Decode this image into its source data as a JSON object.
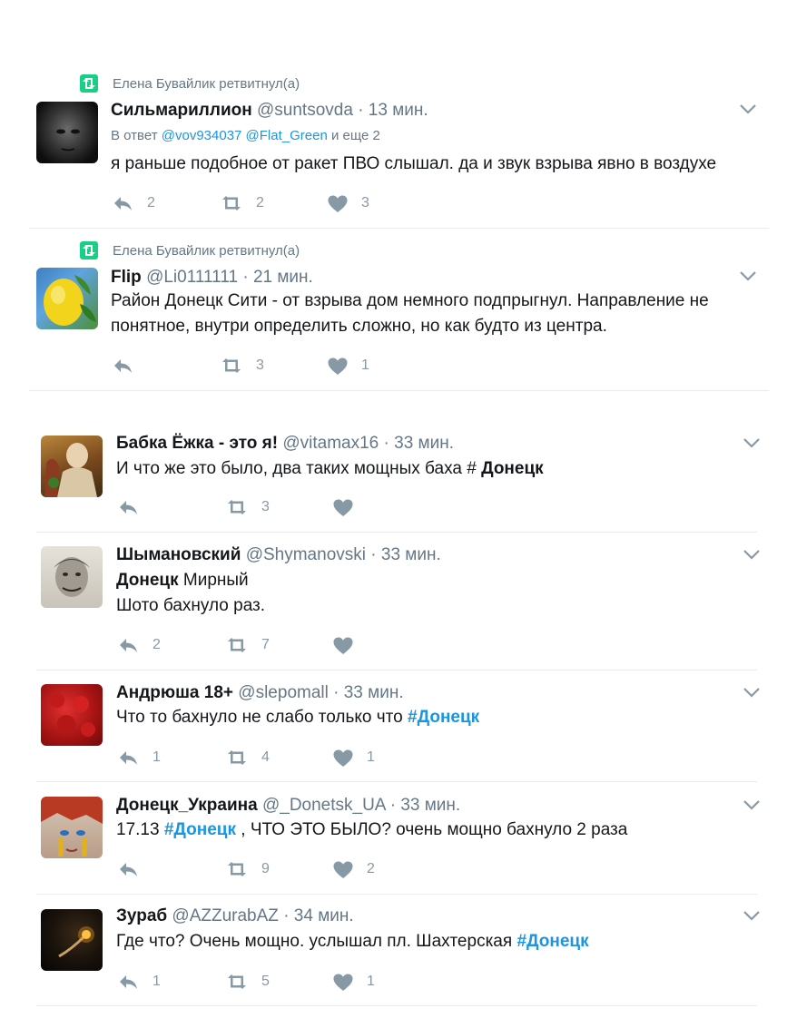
{
  "tweets": [
    {
      "retweeter": "Елена Бувайлик ретвитнул(а)",
      "name": "Сильмариллион",
      "handle": "@suntsovda",
      "time": "13 мин.",
      "reply_prefix": "В ответ",
      "reply_mention1": "@vov934037",
      "reply_mention2": "@Flat_Green",
      "reply_suffix": "и еще 2",
      "line1": "я раньше подобное от ракет ПВО слышал. да и звук взрыва явно в воздухе",
      "replies": "2",
      "retweets": "2",
      "likes": "3"
    },
    {
      "retweeter": "Елена Бувайлик ретвитнул(а)",
      "name": "Flip",
      "handle": "@Li0111111",
      "time": "21 мин.",
      "line1": "Район Донецк Сити - от взрыва дом немного подпрыгнул. Направление не",
      "line2": "понятное, внутри определить сложно, но как будто из центра.",
      "replies": "",
      "retweets": "3",
      "likes": "1"
    },
    {
      "name": "Бабка Ёжка - это я!",
      "handle": "@vitamax16",
      "time": "33 мин.",
      "line1_pre": "И что же это было, два таких мощных баха # ",
      "line1_bold": "Донецк",
      "replies": "",
      "retweets": "3",
      "likes": ""
    },
    {
      "name": "Шымановский",
      "handle": "@Shymanovski",
      "time": "33 мин.",
      "line1_bold": "Донецк",
      "line1_rest": " Мирный",
      "line2": "Шото бахнуло раз.",
      "replies": "2",
      "retweets": "7",
      "likes": ""
    },
    {
      "name": "Андрюша 18+",
      "handle": "@slepomall",
      "time": "33 мин.",
      "line1_pre": "Что то бахнуло не слабо только что ",
      "line1_hash": "#Донецк",
      "replies": "1",
      "retweets": "4",
      "likes": "1"
    },
    {
      "name": "Донецк_Украина",
      "handle": "@_Donetsk_UA",
      "time": "33 мин.",
      "line1_pre": "17.13 ",
      "line1_hash": "#Донецк",
      "line1_rest": " , ЧТО ЭТО БЫЛО? очень мощно бахнуло 2 раза",
      "replies": "",
      "retweets": "9",
      "likes": "2"
    },
    {
      "name": "Зураб",
      "handle": "@AZZurabAZ",
      "time": "34 мин.",
      "line1_pre": "Где что? Очень мощно. услышал пл. Шахтерская ",
      "line1_hash": "#Донецк",
      "replies": "1",
      "retweets": "5",
      "likes": "1"
    }
  ],
  "separator": "·"
}
